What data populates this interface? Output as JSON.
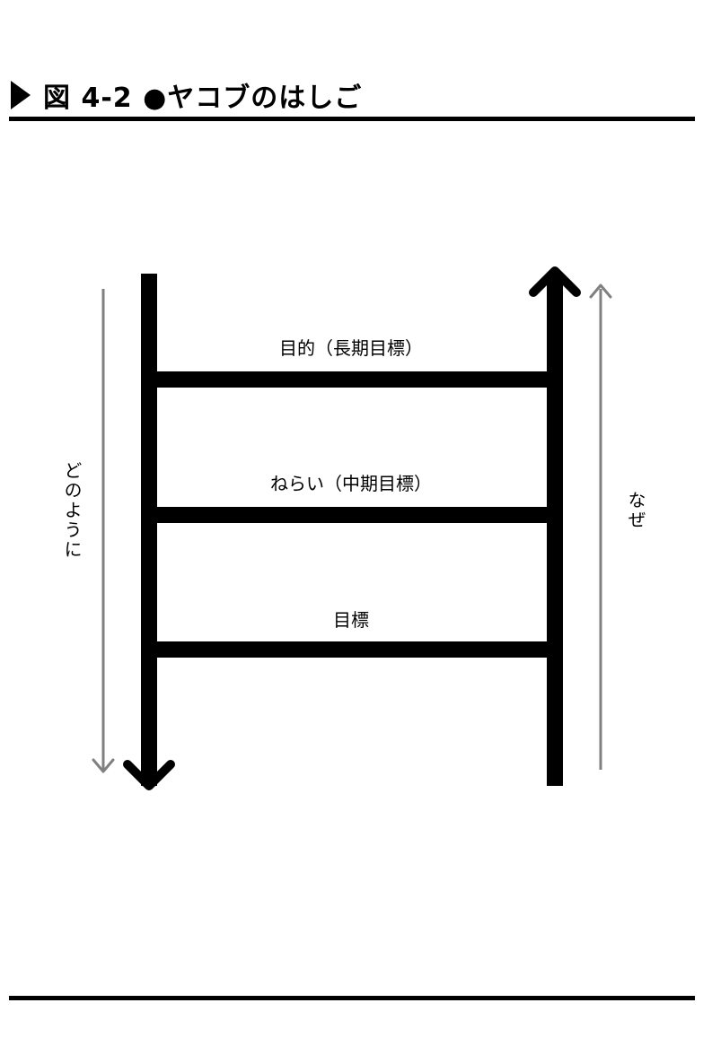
{
  "header": {
    "title": "図 4-2 ●ヤコブのはしご"
  },
  "ladder": {
    "rungs": [
      {
        "label": "目的（長期目標）"
      },
      {
        "label": "ねらい（中期目標）"
      },
      {
        "label": "目標"
      }
    ],
    "left_arrow_label": "どのように",
    "right_arrow_label": "なぜ",
    "side_arrow_color": "#808080",
    "rail_color": "#000000"
  }
}
